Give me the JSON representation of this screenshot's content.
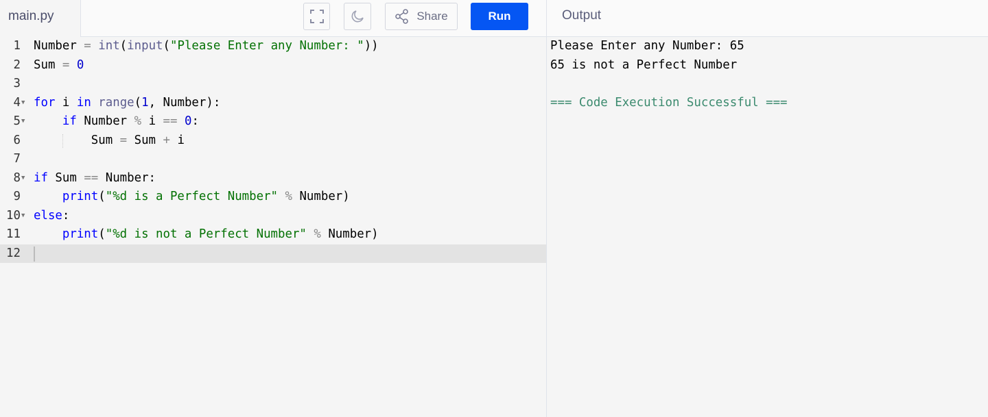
{
  "file_tab": "main.py",
  "toolbar": {
    "share_label": "Share",
    "run_label": "Run",
    "fullscreen_icon": "fullscreen-icon",
    "theme_icon": "moon-icon",
    "share_icon": "share-icon"
  },
  "output": {
    "title": "Output",
    "lines": [
      "Please Enter any Number: 65",
      "65 is not a Perfect Number",
      "",
      "=== Code Execution Successful ==="
    ]
  },
  "colors": {
    "run_button": "#0556f3",
    "keyword": "#0000ff",
    "string": "#037103",
    "success": "#3b8a6e"
  },
  "editor": {
    "active_line": 12,
    "lines": [
      {
        "n": "1",
        "fold": false,
        "tokens": [
          [
            "Number",
            "id"
          ],
          [
            " = ",
            "op"
          ],
          [
            "int",
            "bi"
          ],
          [
            "(",
            "id"
          ],
          [
            "input",
            "bi"
          ],
          [
            "(",
            "id"
          ],
          [
            "\"Please Enter any Number: \"",
            "str"
          ],
          [
            "))",
            "id"
          ]
        ]
      },
      {
        "n": "2",
        "fold": false,
        "tokens": [
          [
            "Sum",
            "id"
          ],
          [
            " = ",
            "op"
          ],
          [
            "0",
            "num"
          ]
        ]
      },
      {
        "n": "3",
        "fold": false,
        "tokens": []
      },
      {
        "n": "4",
        "fold": true,
        "tokens": [
          [
            "for",
            "kw"
          ],
          [
            " i ",
            "id"
          ],
          [
            "in",
            "kw"
          ],
          [
            " ",
            "id"
          ],
          [
            "range",
            "bi"
          ],
          [
            "(",
            "id"
          ],
          [
            "1",
            "num"
          ],
          [
            ", Number):",
            "id"
          ]
        ]
      },
      {
        "n": "5",
        "fold": true,
        "tokens": [
          [
            "    ",
            "id"
          ],
          [
            "if",
            "kw"
          ],
          [
            " Number ",
            "id"
          ],
          [
            "%",
            "op"
          ],
          [
            " i ",
            "id"
          ],
          [
            "==",
            "op"
          ],
          [
            " ",
            "id"
          ],
          [
            "0",
            "num"
          ],
          [
            ":",
            "id"
          ]
        ]
      },
      {
        "n": "6",
        "fold": false,
        "tokens": [
          [
            "        Sum ",
            "id"
          ],
          [
            "=",
            "op"
          ],
          [
            " Sum ",
            "id"
          ],
          [
            "+",
            "op"
          ],
          [
            " i",
            "id"
          ]
        ]
      },
      {
        "n": "7",
        "fold": false,
        "tokens": []
      },
      {
        "n": "8",
        "fold": true,
        "tokens": [
          [
            "if",
            "kw"
          ],
          [
            " Sum ",
            "id"
          ],
          [
            "==",
            "op"
          ],
          [
            " Number:",
            "id"
          ]
        ]
      },
      {
        "n": "9",
        "fold": false,
        "tokens": [
          [
            "    ",
            "id"
          ],
          [
            "print",
            "kw"
          ],
          [
            "(",
            "id"
          ],
          [
            "\"%d is a Perfect Number\"",
            "str"
          ],
          [
            " % ",
            "op"
          ],
          [
            "Number)",
            "id"
          ]
        ]
      },
      {
        "n": "10",
        "fold": true,
        "tokens": [
          [
            "else",
            "kw"
          ],
          [
            ":",
            "id"
          ]
        ]
      },
      {
        "n": "11",
        "fold": false,
        "tokens": [
          [
            "    ",
            "id"
          ],
          [
            "print",
            "kw"
          ],
          [
            "(",
            "id"
          ],
          [
            "\"%d is not a Perfect Number\"",
            "str"
          ],
          [
            " % ",
            "op"
          ],
          [
            "Number)",
            "id"
          ]
        ]
      },
      {
        "n": "12",
        "fold": false,
        "tokens": []
      }
    ]
  }
}
